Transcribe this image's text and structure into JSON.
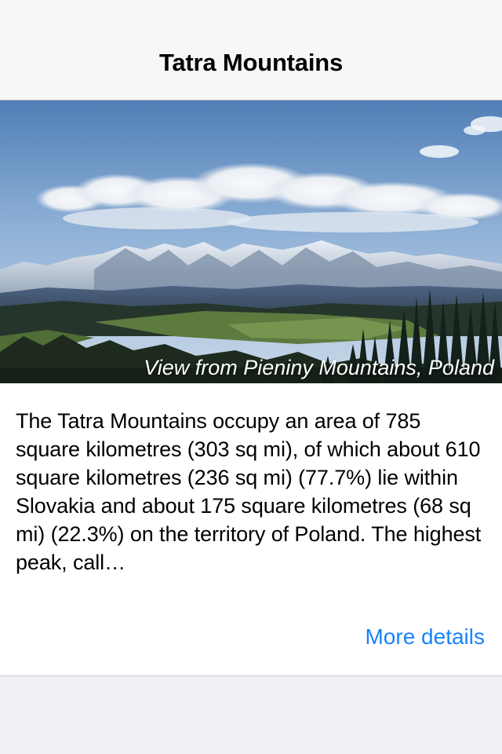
{
  "navbar": {
    "title": "Tatra Mountains"
  },
  "hero": {
    "caption": "View from Pieniny Mountains, Poland"
  },
  "content": {
    "description": "The Tatra Mountains occupy an area of 785 square kilometres (303 sq mi), of which about 610 square kilometres (236 sq mi) (77.7%) lie within Slovakia and about 175 square kilometres (68 sq mi) (22.3%) on the territory of Poland. The highest peak, call…",
    "more_label": "More details"
  },
  "colors": {
    "link": "#1a82fb",
    "navbar_bg": "#f7f7f7",
    "page_bg": "#efeff4"
  }
}
